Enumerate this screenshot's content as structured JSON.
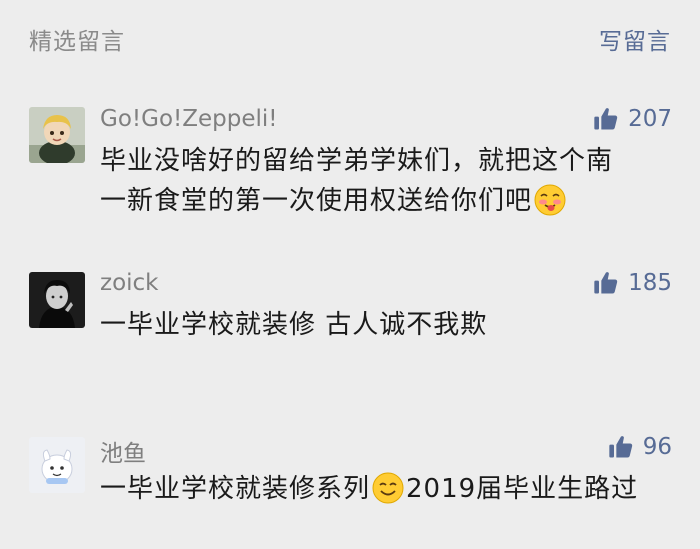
{
  "header": {
    "title": "精选留言",
    "write_label": "写留言"
  },
  "comments": [
    {
      "nickname": "Go!Go!Zeppeli!",
      "likes": "207",
      "text_line1": "毕业没啥好的留给学弟学妹们，就把这个南",
      "text_line2": "一新食堂的第一次使用权送给你们吧",
      "emoji": "blushing-tongue-emoji"
    },
    {
      "nickname": "zoick",
      "likes": "185",
      "text": "一毕业学校就装修 古人诚不我欺"
    },
    {
      "nickname": "池鱼",
      "likes": "96",
      "text_before_emoji": "一毕业学校就装修系列",
      "emoji": "smile-emoji",
      "text_after_emoji": "2019届毕业生路过"
    }
  ],
  "colors": {
    "background": "#ededed",
    "link_blue": "#576b95",
    "gray_text": "#8a8a8a",
    "body_text": "#1a1a1a"
  }
}
